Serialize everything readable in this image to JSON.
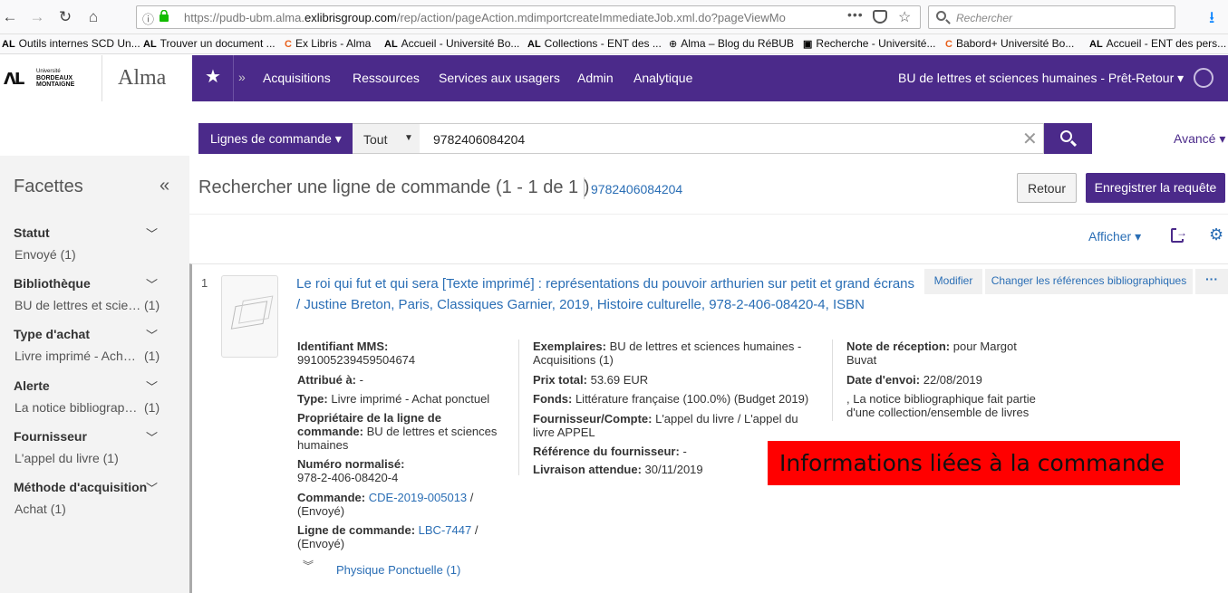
{
  "browser": {
    "url_prefix": "https://pudb-ubm.alma.",
    "url_domain": "exlibrisgroup.com",
    "url_rest": "/rep/action/pageAction.mdimportcreateImmediateJob.xml.do?pageViewMo",
    "search_placeholder": "Rechercher",
    "bookmarks": [
      {
        "icon": "AL",
        "label": "Outils internes SCD Un..."
      },
      {
        "icon": "AL",
        "label": "Trouver un document ..."
      },
      {
        "icon": "C",
        "label": "Ex Libris - Alma"
      },
      {
        "icon": "AL",
        "label": "Accueil - Université Bo..."
      },
      {
        "icon": "AL",
        "label": "Collections - ENT des ..."
      },
      {
        "icon": "globe",
        "label": "Alma – Blog du RéBUB"
      },
      {
        "icon": "img",
        "label": "Recherche - Université..."
      },
      {
        "icon": "C",
        "label": "Babord+ Université Bo..."
      },
      {
        "icon": "AL",
        "label": "Accueil - ENT des pers..."
      }
    ]
  },
  "header": {
    "logo_line1": "Université",
    "logo_line2": "BORDEAUX",
    "logo_line3": "MONTAIGNE",
    "app_name": "Alma",
    "menu": [
      "Acquisitions",
      "Ressources",
      "Services aux usagers",
      "Admin",
      "Analytique"
    ],
    "location": "BU de lettres et sciences humaines - Prêt-Retour ▾"
  },
  "search": {
    "scope": "Lignes de commande ▾",
    "filter": "Tout",
    "query": "9782406084204",
    "advanced": "Avancé ▾"
  },
  "facets": {
    "title": "Facettes",
    "groups": [
      {
        "name": "Statut",
        "value": "Envoyé",
        "count": "(1)"
      },
      {
        "name": "Bibliothèque",
        "value": "BU de lettres et sciences humaines",
        "count": "(1)"
      },
      {
        "name": "Type d'achat",
        "value": "Livre imprimé - Achat ponctuel",
        "count": "(1)"
      },
      {
        "name": "Alerte",
        "value": "La notice bibliographique fait partie",
        "count": "(1)"
      },
      {
        "name": "Fournisseur",
        "value": "L'appel du livre (1)",
        "count": ""
      },
      {
        "name": "Méthode d'acquisition",
        "value": "Achat (1)",
        "count": ""
      }
    ]
  },
  "results": {
    "heading": "Rechercher une ligne de commande (1 - 1 de 1 )",
    "query": "9782406084204",
    "back": "Retour",
    "save": "Enregistrer la requête",
    "display": "Afficher ▾"
  },
  "record": {
    "number": "1",
    "title": "Le roi qui fut et qui sera [Texte imprimé] : représentations du pouvoir arthurien sur petit et grand écrans / Justine Breton, Paris, Classiques Garnier, 2019, Histoire culturelle, 978-2-406-08420-4, ISBN",
    "btn_edit": "Modifier",
    "btn_change": "Changer les références bibliographiques",
    "btn_more": "···",
    "col1": {
      "mms_label": "Identifiant MMS:",
      "mms_value": "991005239459504674",
      "assigned_label": "Attribué à:",
      "assigned_value": "-",
      "type_label": "Type:",
      "type_value": "Livre imprimé - Achat ponctuel",
      "owner_label": "Propriétaire de la ligne de commande:",
      "owner_value": "BU de lettres et sciences humaines",
      "isbn_label": "Numéro normalisé:",
      "isbn_value": "978-2-406-08420-4",
      "order_label": "Commande:",
      "order_link": "CDE-2019-005013",
      "order_status": "/ (Envoyé)",
      "line_label": "Ligne de commande:",
      "line_link": "LBC-7447",
      "line_status": "/ (Envoyé)"
    },
    "col2": {
      "copies_label": "Exemplaires:",
      "copies_value": "BU de lettres et sciences humaines - Acquisitions (1)",
      "price_label": "Prix total:",
      "price_value": "53.69 EUR",
      "fund_label": "Fonds:",
      "fund_value": "Littérature française (100.0%) (Budget 2019)",
      "vendor_label": "Fournisseur/Compte:",
      "vendor_value": "L'appel du livre / L'appel du livre APPEL",
      "vref_label": "Référence du fournisseur:",
      "vref_value": "-",
      "delivery_label": "Livraison attendue:",
      "delivery_value": "30/11/2019"
    },
    "col3": {
      "note_label": "Note de réception:",
      "note_value": "pour Margot Buvat",
      "sent_label": "Date d'envoi:",
      "sent_value": "22/08/2019",
      "alert_value": ", La notice bibliographique fait partie d'une collection/ensemble de livres"
    },
    "physical": "Physique Ponctuelle (1)"
  },
  "annotation": "Informations liées à la commande"
}
